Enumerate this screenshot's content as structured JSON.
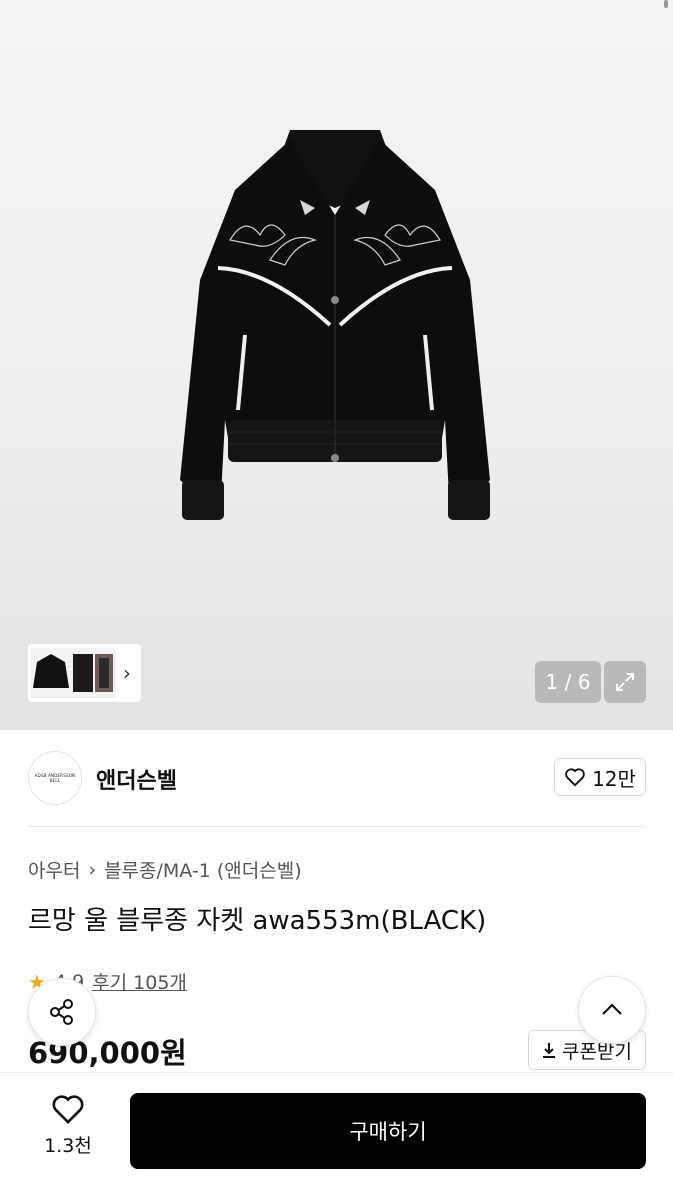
{
  "gallery": {
    "counter": "1 / 6",
    "expand_icon": "expand-icon",
    "thumbnail_next_icon": "chevron-right-icon"
  },
  "brand": {
    "logo_text": "ADSB ANDERSSON BELL",
    "name": "앤더슨벨",
    "like_count": "12만"
  },
  "product": {
    "breadcrumb": [
      "아우터",
      "블루종/MA-1 (앤더슨벨)"
    ],
    "title": "르망 울 블루종 자켓 awa553m(BLACK)",
    "rating": "4.9",
    "review_text": "후기 105개",
    "price": "690,000원",
    "coupon_label": "쿠폰받기"
  },
  "bottom_bar": {
    "wish_count": "1.3천",
    "buy_label": "구매하기"
  },
  "colors": {
    "buy_button": "#000000",
    "star": "#f5a623"
  }
}
